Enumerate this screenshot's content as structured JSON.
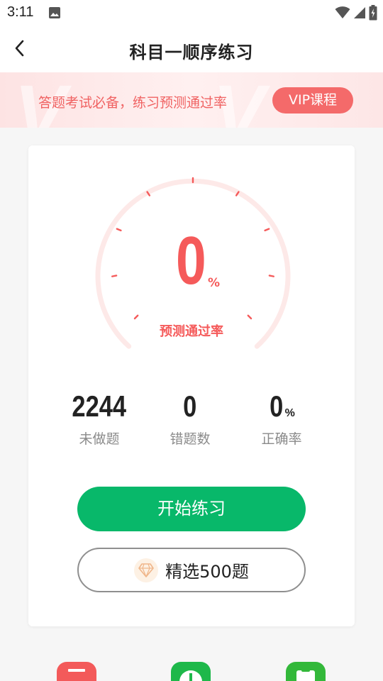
{
  "status_bar": {
    "time": "3:11"
  },
  "nav": {
    "title": "科目一顺序练习"
  },
  "banner": {
    "text": "答题考试必备，练习预测通过率",
    "button": "VIP课程"
  },
  "gauge": {
    "value": "0",
    "unit": "%",
    "label": "预测通过率",
    "progress_fraction": 0
  },
  "stats": [
    {
      "value": "2244",
      "unit": "",
      "label": "未做题"
    },
    {
      "value": "0",
      "unit": "",
      "label": "错题数"
    },
    {
      "value": "0",
      "unit": "%",
      "label": "正确率"
    }
  ],
  "actions": {
    "start": "开始练习",
    "selected": "精选500题"
  },
  "colors": {
    "accent_red": "#f55a5a",
    "primary_green": "#08b86a",
    "gauge_track": "#fde9e8"
  },
  "icons": {
    "back": "chevron-left-icon",
    "diamond": "diamond-icon",
    "gallery": "gallery-icon",
    "wifi": "wifi-icon",
    "signal": "signal-icon",
    "battery": "battery-icon"
  }
}
